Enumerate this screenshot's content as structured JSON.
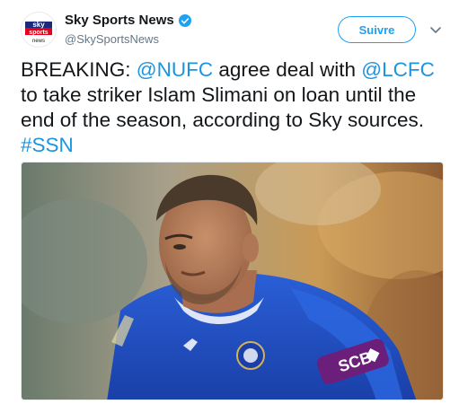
{
  "account": {
    "logo_text_top": "sky",
    "logo_text_mid": "sports",
    "logo_text_bottom": "news",
    "display_name": "Sky Sports News",
    "handle": "@SkySportsNews",
    "verified": true
  },
  "actions": {
    "follow_label": "Suivre"
  },
  "tweet": {
    "prefix": "BREAKING: ",
    "mention1": "@NUFC",
    "mid1": " agree deal with ",
    "mention2": "@LCFC",
    "mid2": " to take striker Islam Slimani on loan until the end of the season, according to Sky sources.",
    "hashtag": "#SSN"
  },
  "photo": {
    "sponsor_text": "SCB"
  },
  "colors": {
    "link": "#1b95e0",
    "follow": "#1da1f2",
    "jersey": "#1c4dc4",
    "sky_red": "#e3001b"
  }
}
